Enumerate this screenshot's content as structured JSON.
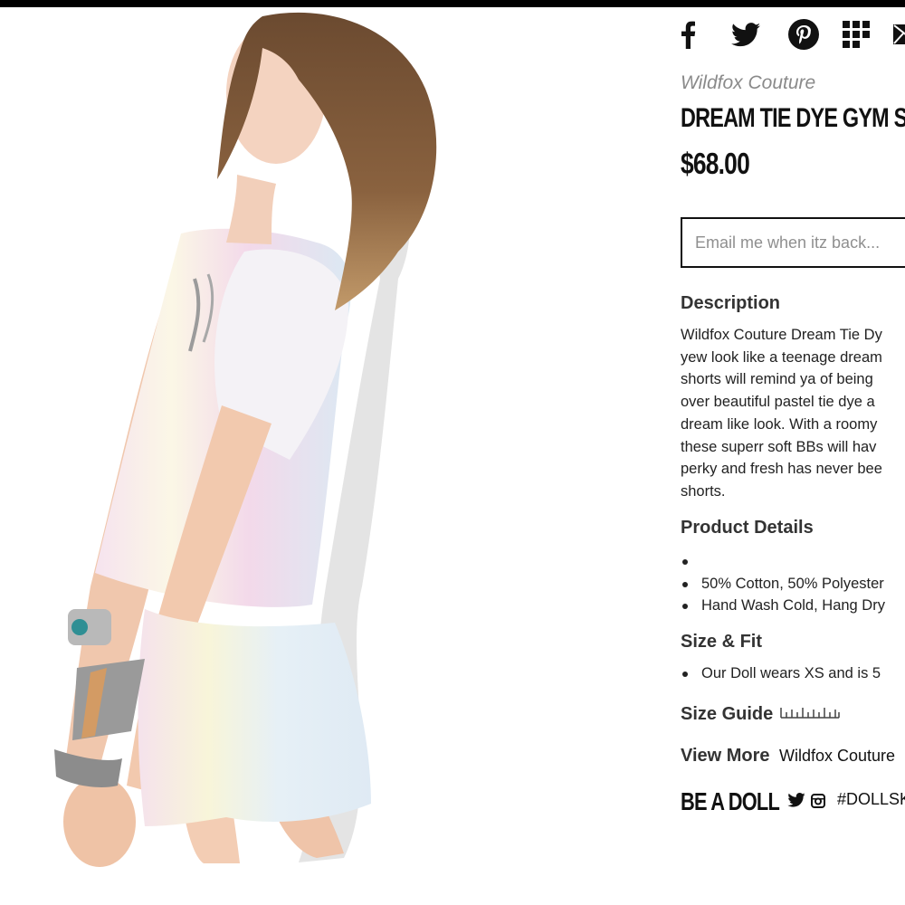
{
  "social": {
    "icons": [
      "facebook-icon",
      "twitter-icon",
      "pinterest-icon",
      "fancy-icon",
      "email-icon"
    ]
  },
  "product": {
    "brand": "Wildfox Couture",
    "title": "DREAM TIE DYE GYM S",
    "price": "$68.00",
    "email_placeholder": "Email me when itz back..."
  },
  "description": {
    "heading": "Description",
    "lines": [
      "Wildfox Couture Dream Tie Dy",
      "yew look like a teenage dream",
      "shorts will remind ya of being",
      "over beautiful pastel tie dye a",
      "dream like look. With a roomy",
      "these superr soft BBs will hav",
      "perky and fresh has never bee",
      "shorts."
    ]
  },
  "product_details": {
    "heading": "Product Details",
    "items": [
      "",
      "50% Cotton, 50% Polyester",
      "Hand Wash Cold, Hang Dry"
    ]
  },
  "size_fit": {
    "heading": "Size & Fit",
    "items": [
      "Our Doll wears XS and is 5"
    ]
  },
  "size_guide": {
    "label": "Size Guide",
    "icon": "ruler-icon"
  },
  "view_more": {
    "label": "View More",
    "link": "Wildfox Couture"
  },
  "be_a_doll": {
    "label": "BE A DOLL",
    "hashtag": "#DOLLSK",
    "icons": [
      "twitter-icon",
      "instagram-icon"
    ]
  },
  "photo": {
    "description_icon": "product-photo"
  }
}
